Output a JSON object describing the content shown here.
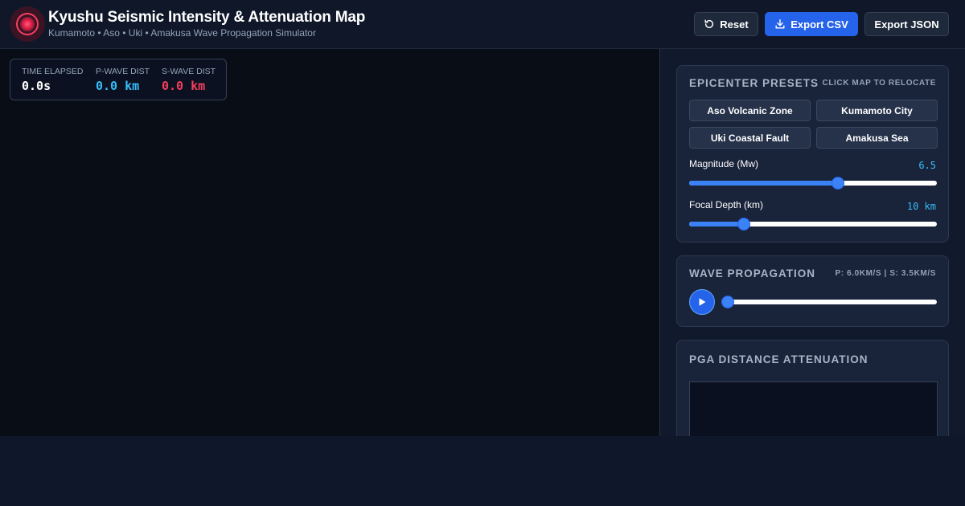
{
  "header": {
    "title": "Kyushu Seismic Intensity & Attenuation Map",
    "subtitle": "Kumamoto • Aso • Uki • Amakusa Wave Propagation Simulator",
    "logo_icon": "seismic-target-icon",
    "buttons": {
      "reset": {
        "label": "Reset",
        "icon": "reset-icon"
      },
      "export_csv": {
        "label": "Export CSV",
        "icon": "download-icon"
      },
      "export_json": {
        "label": "Export JSON"
      }
    }
  },
  "map": {
    "stats": {
      "time_elapsed": {
        "label": "TIME ELAPSED",
        "value": "0.0s",
        "color": "#ffffff"
      },
      "p_wave": {
        "label": "P-WAVE DIST",
        "value": "0.0 km",
        "color": "#38bdf8"
      },
      "s_wave": {
        "label": "S-WAVE DIST",
        "value": "0.0 km",
        "color": "#f43f5e"
      }
    }
  },
  "sidebar": {
    "presets": {
      "title": "EPICENTER PRESETS",
      "note": "CLICK MAP TO RELOCATE",
      "items": [
        {
          "label": "Aso Volcanic Zone"
        },
        {
          "label": "Kumamoto City"
        },
        {
          "label": "Uki Coastal Fault"
        },
        {
          "label": "Amakusa Sea"
        }
      ],
      "magnitude": {
        "label": "Magnitude (Mw)",
        "value": "6.5",
        "fraction": 0.6
      },
      "depth": {
        "label": "Focal Depth (km)",
        "value": "10 km",
        "fraction": 0.22
      }
    },
    "propagation": {
      "title": "WAVE PROPAGATION",
      "note": "P: 6.0KM/S | S: 3.5KM/S",
      "play_icon": "play-icon",
      "progress_fraction": 0
    },
    "pga": {
      "title": "PGA DISTANCE ATTENUATION"
    }
  },
  "colors": {
    "accent": "#2563eb",
    "p_wave": "#38bdf8",
    "s_wave": "#f43f5e",
    "background": "#0f172a"
  }
}
